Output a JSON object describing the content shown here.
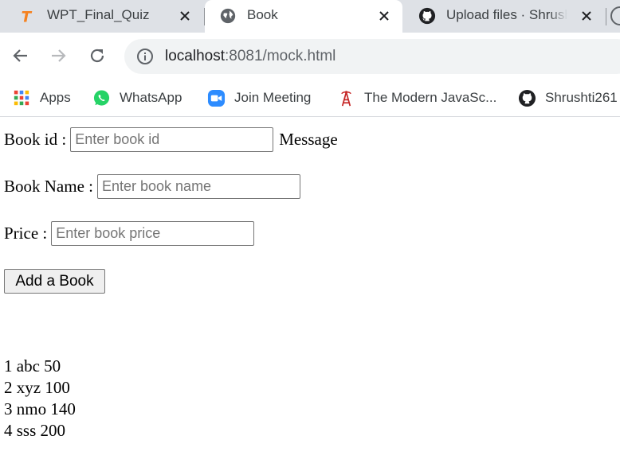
{
  "tabs": [
    {
      "title": "WPT_Final_Quiz",
      "icon": "quiz-logo-icon",
      "active": false
    },
    {
      "title": "Book",
      "icon": "globe-icon",
      "active": true
    },
    {
      "title": "Upload files · Shrushti",
      "icon": "github-icon",
      "active": false
    }
  ],
  "address_bar": {
    "host": "localhost",
    "rest": ":8081/mock.html"
  },
  "bookmarks": [
    {
      "label": "Apps",
      "icon": "apps-grid-icon"
    },
    {
      "label": "WhatsApp",
      "icon": "whatsapp-icon"
    },
    {
      "label": "Join Meeting",
      "icon": "video-camera-icon"
    },
    {
      "label": "The Modern JavaSc...",
      "icon": "tower-icon"
    },
    {
      "label": "Shrushti261",
      "icon": "github-icon"
    }
  ],
  "form": {
    "book_id_label": "Book id :",
    "book_id_placeholder": "Enter book id",
    "message": "Message",
    "book_name_label": "Book Name :",
    "book_name_placeholder": "Enter book name",
    "price_label": "Price :",
    "price_placeholder": "Enter book price",
    "add_button": "Add a Book"
  },
  "books": [
    "1 abc 50",
    "2 xyz 100",
    "3 nmo 140",
    "4 sss 200"
  ],
  "colors": {
    "tabstrip_bg": "#dee1e6",
    "omnibox_bg": "#f1f3f4",
    "whatsapp": "#25d366",
    "zoom_blue": "#2d8cff",
    "quiz_orange": "#f58220",
    "tower_red": "#c62828"
  }
}
